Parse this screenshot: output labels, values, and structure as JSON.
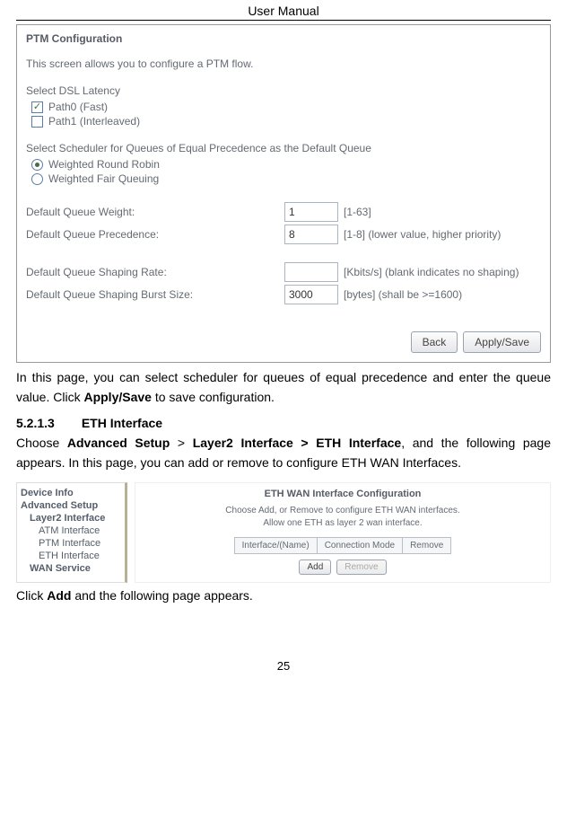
{
  "header_title": "User Manual",
  "ptm": {
    "title": "PTM Configuration",
    "desc": "This screen allows you to configure a PTM flow.",
    "latency_label": "Select DSL Latency",
    "latency_opts": [
      "Path0 (Fast)",
      "Path1 (Interleaved)"
    ],
    "latency_checked": 0,
    "scheduler_label": "Select Scheduler for Queues of Equal Precedence as the Default Queue",
    "scheduler_opts": [
      "Weighted Round Robin",
      "Weighted Fair Queuing"
    ],
    "scheduler_selected": 0,
    "fields": [
      {
        "label": "Default Queue Weight:",
        "value": "1",
        "hint": "[1-63]"
      },
      {
        "label": "Default Queue Precedence:",
        "value": "8",
        "hint": "[1-8] (lower value, higher priority)"
      },
      {
        "label": "Default Queue Shaping Rate:",
        "value": "",
        "hint": "[Kbits/s] (blank indicates no shaping)"
      },
      {
        "label": "Default Queue Shaping Burst Size:",
        "value": "3000",
        "hint": "[bytes] (shall be >=1600)"
      }
    ],
    "buttons": {
      "back": "Back",
      "apply": "Apply/Save"
    }
  },
  "para1_a": "In this page, you can select scheduler for queues of equal precedence and enter the queue value. Click ",
  "para1_b": "Apply/Save",
  "para1_c": " to save configuration.",
  "section": {
    "num": "5.2.1.3",
    "title": "ETH Interface"
  },
  "para2_a": "Choose ",
  "para2_b": "Advanced Setup",
  "para2_c": " > ",
  "para2_d": "Layer2 Interface > ETH Interface",
  "para2_e": ", and the following page appears. In this page, you can add or remove to configure ETH WAN Interfaces.",
  "sidebar": {
    "l0": "Device Info",
    "l0b": "Advanced Setup",
    "l1": "Layer2 Interface",
    "l2a": "ATM Interface",
    "l2b": "PTM Interface",
    "l2c": "ETH Interface",
    "l1b": "WAN Service"
  },
  "eth_panel": {
    "title": "ETH WAN Interface Configuration",
    "desc1": "Choose Add, or Remove to configure ETH WAN interfaces.",
    "desc2": "Allow one ETH as layer 2 wan interface.",
    "cols": [
      "Interface/(Name)",
      "Connection Mode",
      "Remove"
    ],
    "add": "Add",
    "remove": "Remove"
  },
  "para3_a": "Click ",
  "para3_b": "Add",
  "para3_c": " and the following page appears.",
  "page_num": "25"
}
